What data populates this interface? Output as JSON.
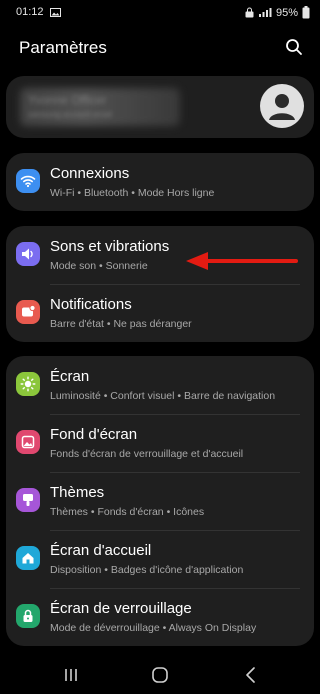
{
  "status": {
    "time": "01:12",
    "battery": "95%"
  },
  "header": {
    "title": "Paramètres"
  },
  "profile": {
    "name": "Yvonne Officer",
    "email": "samsung account email"
  },
  "groups": [
    {
      "items": [
        {
          "title": "Connexions",
          "subtitle": "Wi-Fi  •  Bluetooth  •  Mode Hors ligne",
          "icon": "wifi-icon",
          "color": "#3d8ff1"
        }
      ]
    },
    {
      "items": [
        {
          "title": "Sons et vibrations",
          "subtitle": "Mode son  •  Sonnerie",
          "icon": "volume-icon",
          "color": "#7b6df0"
        },
        {
          "title": "Notifications",
          "subtitle": "Barre d'état  •  Ne pas déranger",
          "icon": "notification-icon",
          "color": "#e85a4f"
        }
      ]
    },
    {
      "items": [
        {
          "title": "Écran",
          "subtitle": "Luminosité  •  Confort visuel  •  Barre de navigation",
          "icon": "sun-icon",
          "color": "#8bc63b"
        },
        {
          "title": "Fond d'écran",
          "subtitle": "Fonds d'écran de verrouillage et d'accueil",
          "icon": "image-icon",
          "color": "#e0486f"
        },
        {
          "title": "Thèmes",
          "subtitle": "Thèmes  •  Fonds d'écran  •  Icônes",
          "icon": "brush-icon",
          "color": "#a656d8"
        },
        {
          "title": "Écran d'accueil",
          "subtitle": "Disposition  •  Badges d'icône d'application",
          "icon": "home-icon",
          "color": "#1fa8d8"
        },
        {
          "title": "Écran de verrouillage",
          "subtitle": "Mode de déverrouillage  •  Always On Display",
          "icon": "lock-icon",
          "color": "#23a76c"
        }
      ]
    }
  ],
  "annotation": {
    "arrow_color": "#e31b12"
  }
}
